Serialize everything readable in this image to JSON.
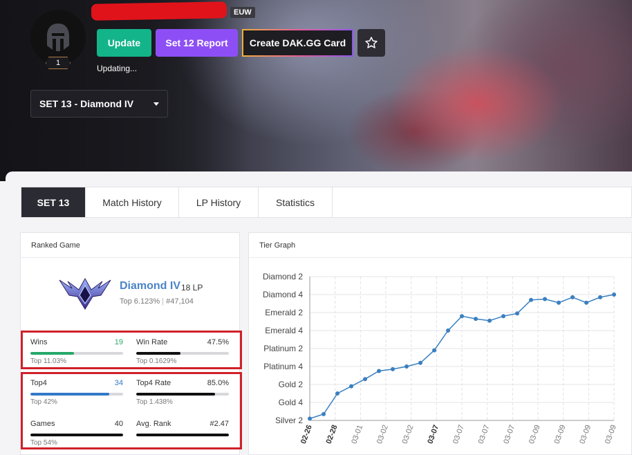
{
  "header": {
    "region": "EUW",
    "level": "1",
    "buttons": {
      "update": "Update",
      "report": "Set 12 Report",
      "card": "Create DAK.GG Card"
    },
    "status": "Updating...",
    "set_select": "SET 13 - Diamond IV"
  },
  "tabs": [
    "SET 13",
    "Match History",
    "LP History",
    "Statistics"
  ],
  "ranked": {
    "title": "Ranked Game",
    "rank": "Diamond IV",
    "lp": "18 LP",
    "top_pct": "Top 6.123%",
    "rank_no": "#47,104",
    "stats": [
      {
        "label": "Wins",
        "value": "19",
        "sub": "Top 11.03%",
        "fill": 0.47,
        "color": "#27a86a"
      },
      {
        "label": "Win Rate",
        "value": "47.5%",
        "sub": "Top 0.1629%",
        "fill": 0.475,
        "color": "#111111"
      },
      {
        "label": "Top4",
        "value": "34",
        "sub": "Top 42%",
        "fill": 0.85,
        "color": "#3278c8"
      },
      {
        "label": "Top4 Rate",
        "value": "85.0%",
        "sub": "Top 1.438%",
        "fill": 0.85,
        "color": "#111111"
      },
      {
        "label": "Games",
        "value": "40",
        "sub": "Top 54%",
        "fill": 1.0,
        "color": "#111111"
      },
      {
        "label": "Avg. Rank",
        "value": "#2.47",
        "sub": "",
        "fill": 1.0,
        "color": "#111111"
      }
    ]
  },
  "tier_graph": {
    "title": "Tier Graph"
  },
  "chart_data": {
    "type": "line",
    "y_tick_labels": [
      "Diamond 2",
      "Diamond 4",
      "Emerald 2",
      "Emerald 4",
      "Platinum 2",
      "Platinum 4",
      "Gold 2",
      "Gold 4",
      "Silver 2"
    ],
    "x_tick_labels": [
      "02-26",
      "02-28",
      "03-01",
      "03-02",
      "03-02",
      "03-07",
      "03-07",
      "03-07",
      "03-07",
      "03-09",
      "03-09",
      "03-09",
      "03-09"
    ],
    "x_tick_bold": [
      true,
      true,
      false,
      false,
      false,
      true,
      false,
      false,
      false,
      false,
      false,
      false,
      false
    ],
    "series": [
      {
        "values": [
          0.1,
          0.35,
          1.5,
          1.9,
          2.3,
          2.75,
          2.85,
          3.0,
          3.2,
          3.9,
          5.0,
          5.8,
          5.65,
          5.55,
          5.8,
          5.95,
          6.7,
          6.75,
          6.55,
          6.85,
          6.55,
          6.85,
          7.0
        ]
      }
    ],
    "ylim": [
      0,
      8
    ]
  }
}
